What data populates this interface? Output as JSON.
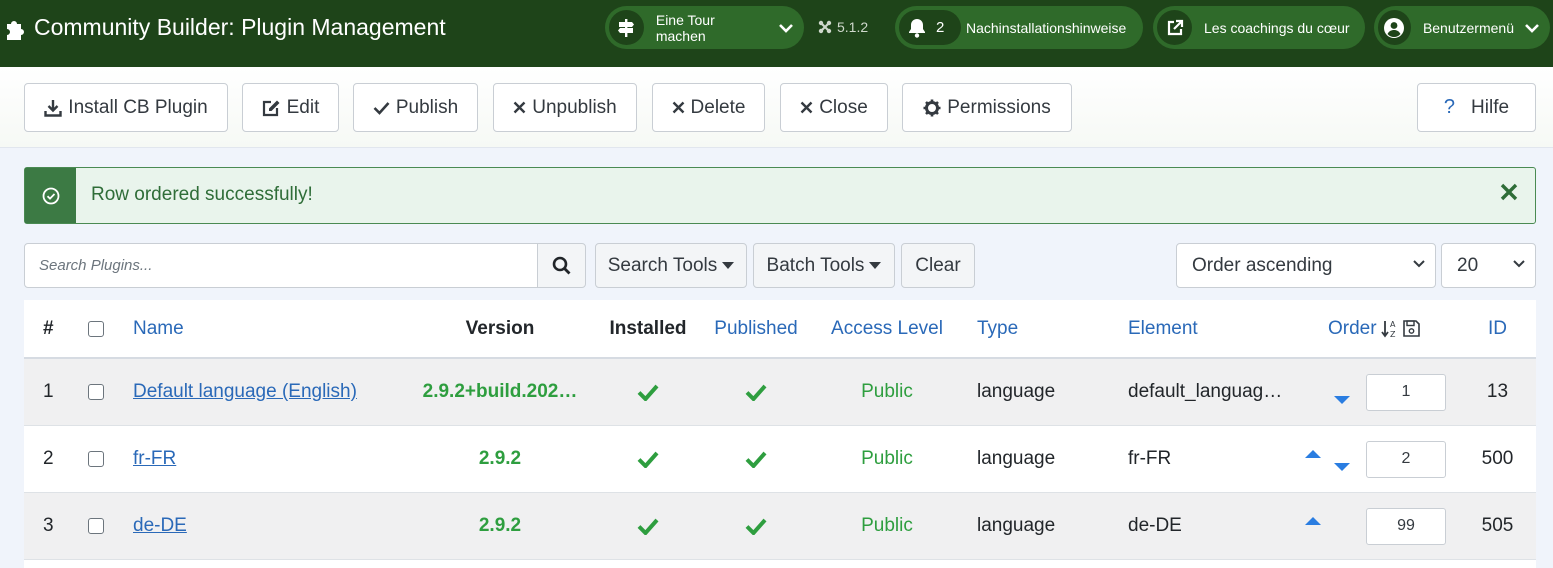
{
  "header": {
    "title": "Community Builder: Plugin Management",
    "tour_label": "Eine Tour machen",
    "version": "5.1.2",
    "notifications_count": "2",
    "notifications_label": "Nachinstallationshinweise",
    "site_link_label": "Les coachings du cœur",
    "user_menu_label": "Benutzermenü"
  },
  "toolbar": {
    "install_label": "Install CB Plugin",
    "edit_label": "Edit",
    "publish_label": "Publish",
    "unpublish_label": "Unpublish",
    "delete_label": "Delete",
    "close_label": "Close",
    "permissions_label": "Permissions",
    "help_label": "Hilfe"
  },
  "alert": {
    "message": "Row ordered successfully!"
  },
  "filters": {
    "search_placeholder": "Search Plugins...",
    "search_tools_label": "Search Tools",
    "batch_tools_label": "Batch Tools",
    "clear_label": "Clear",
    "ordering_value": "Order ascending",
    "limit_value": "20"
  },
  "table": {
    "headers": {
      "num": "#",
      "name": "Name",
      "version": "Version",
      "installed": "Installed",
      "published": "Published",
      "access": "Access Level",
      "type": "Type",
      "element": "Element",
      "order": "Order",
      "id": "ID"
    },
    "rows": [
      {
        "num": "1",
        "name": "Default language (English)",
        "version": "2.9.2+build.202…",
        "access": "Public",
        "type": "language",
        "element": "default_languag…",
        "order": "1",
        "id": "13"
      },
      {
        "num": "2",
        "name": "fr-FR",
        "version": "2.9.2",
        "access": "Public",
        "type": "language",
        "element": "fr-FR",
        "order": "2",
        "id": "500"
      },
      {
        "num": "3",
        "name": "de-DE",
        "version": "2.9.2",
        "access": "Public",
        "type": "language",
        "element": "de-DE",
        "order": "99",
        "id": "505"
      }
    ]
  },
  "colors": {
    "header_bg": "#1e4419",
    "pill_bg": "#2f6a2a",
    "link": "#2a69b8",
    "success": "#2e9e3f",
    "order_arrow": "#2a7de1"
  }
}
